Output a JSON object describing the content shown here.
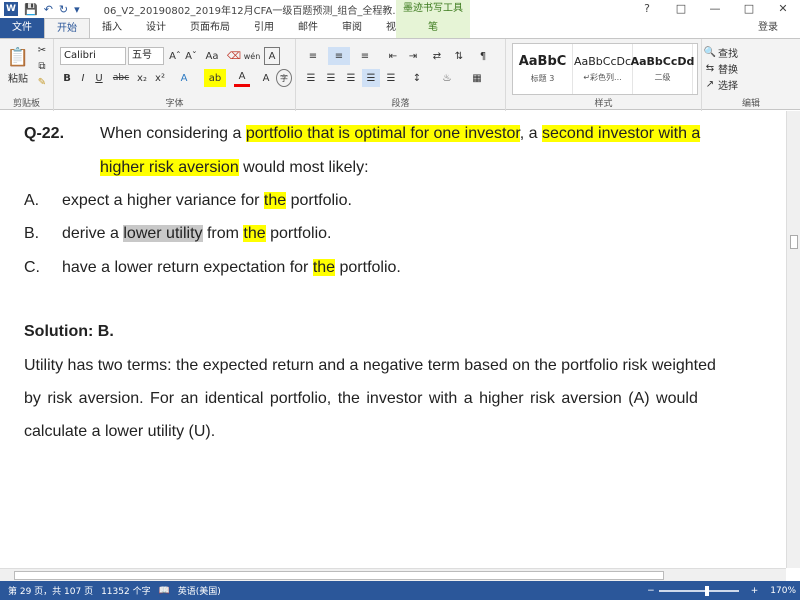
{
  "titlebar": {
    "doc_title": "06_V2_20190802_2019年12月CFA一级百题预测_组合_全程教...",
    "ink_tools": "墨迹书写工具",
    "win_icon": "W"
  },
  "tabs": {
    "file": "文件",
    "home": "开始",
    "insert": "插入",
    "design": "设计",
    "layout": "页面布局",
    "references": "引用",
    "mailings": "邮件",
    "review": "审阅",
    "view": "视图",
    "pen": "笔",
    "login": "登录"
  },
  "ribbon": {
    "clipboard": {
      "paste": "粘贴",
      "label": "剪贴板"
    },
    "font": {
      "family": "Calibri",
      "size": "五号",
      "label": "字体"
    },
    "paragraph": {
      "label": "段落"
    },
    "styles": {
      "label": "样式",
      "items": [
        {
          "sample": "AaBbC",
          "name": "标题 3"
        },
        {
          "sample": "AaBbCcDc",
          "name": "↵彩色列..."
        },
        {
          "sample": "AaBbCcDd",
          "name": "二级"
        }
      ]
    },
    "editing": {
      "find": "查找",
      "replace": "替换",
      "select": "选择",
      "label": "编辑"
    }
  },
  "document": {
    "q_number": "Q-22.",
    "q_line1": [
      "When considering a ",
      "portfolio that is optimal for one investor",
      ", a ",
      "second investor with a"
    ],
    "q_line2": [
      "higher risk aversion",
      " would most likely:"
    ],
    "options": [
      {
        "letter": "A.",
        "parts": [
          "expect a higher variance for ",
          "the",
          " portfolio."
        ]
      },
      {
        "letter": "B.",
        "parts": [
          "derive a ",
          "lower utility",
          " from ",
          "the",
          " portfolio."
        ]
      },
      {
        "letter": "C.",
        "parts": [
          "have a lower return expectation for ",
          "the",
          " portfolio."
        ]
      }
    ],
    "solution_title": "Solution: B.",
    "solution_lines": [
      "Utility has two terms: the expected return and a negative term based on the portfolio risk weighted",
      "by risk aversion. For an identical portfolio, the investor with a higher risk aversion (A) would",
      "calculate a lower utility (U)."
    ]
  },
  "status": {
    "page": "第 29 页，共 107 页",
    "words": "11352 个字",
    "lang": "英语(美国)",
    "zoom": "170%",
    "zoom_fraction": 0.6
  },
  "colors": {
    "accent": "#2b579a",
    "highlight_yellow": "#ffff00",
    "highlight_gray": "#c8c8c8"
  }
}
